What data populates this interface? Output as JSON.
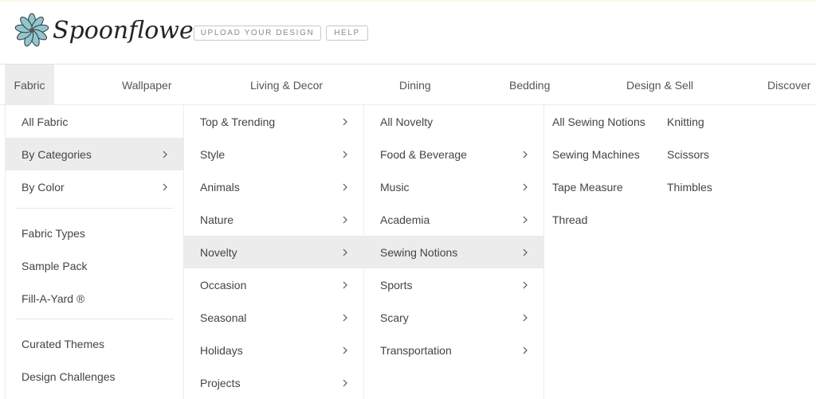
{
  "header": {
    "logo_text": "Spoonflower",
    "upload_button": "UPLOAD YOUR DESIGN",
    "help_button": "HELP"
  },
  "nav": {
    "items": [
      {
        "label": "Fabric",
        "active": true
      },
      {
        "label": "Wallpaper"
      },
      {
        "label": "Living & Decor"
      },
      {
        "label": "Dining"
      },
      {
        "label": "Bedding"
      },
      {
        "label": "Design & Sell"
      },
      {
        "label": "Discover"
      }
    ]
  },
  "menu": {
    "fabric": {
      "items": [
        {
          "label": "All Fabric",
          "has_submenu": false
        },
        {
          "label": "By Categories",
          "has_submenu": true,
          "selected": true
        },
        {
          "label": "By Color",
          "has_submenu": true
        },
        {
          "label": "Fabric Types",
          "has_submenu": false
        },
        {
          "label": "Sample Pack",
          "has_submenu": false
        },
        {
          "label": "Fill-A-Yard ®",
          "has_submenu": false
        },
        {
          "label": "Curated Themes",
          "has_submenu": false
        },
        {
          "label": "Design Challenges",
          "has_submenu": false
        }
      ]
    },
    "categories": {
      "items": [
        {
          "label": "Top & Trending",
          "has_submenu": true
        },
        {
          "label": "Style",
          "has_submenu": true
        },
        {
          "label": "Animals",
          "has_submenu": true
        },
        {
          "label": "Nature",
          "has_submenu": true
        },
        {
          "label": "Novelty",
          "has_submenu": true,
          "selected": true
        },
        {
          "label": "Occasion",
          "has_submenu": true
        },
        {
          "label": "Seasonal",
          "has_submenu": true
        },
        {
          "label": "Holidays",
          "has_submenu": true
        },
        {
          "label": "Projects",
          "has_submenu": true
        }
      ]
    },
    "novelty": {
      "items": [
        {
          "label": "All Novelty",
          "has_submenu": false
        },
        {
          "label": "Food & Beverage",
          "has_submenu": true
        },
        {
          "label": "Music",
          "has_submenu": true
        },
        {
          "label": "Academia",
          "has_submenu": true
        },
        {
          "label": "Sewing Notions",
          "has_submenu": true,
          "selected": true
        },
        {
          "label": "Sports",
          "has_submenu": true
        },
        {
          "label": "Scary",
          "has_submenu": true
        },
        {
          "label": "Transportation",
          "has_submenu": true
        }
      ]
    },
    "sewing_notions": {
      "items": [
        {
          "label": "All Sewing Notions"
        },
        {
          "label": "Knitting"
        },
        {
          "label": "Sewing Machines"
        },
        {
          "label": "Scissors"
        },
        {
          "label": "Tape Measure"
        },
        {
          "label": "Thimbles"
        },
        {
          "label": "Thread"
        }
      ]
    }
  },
  "colors": {
    "selected_bg": "#ececec",
    "logo_flower": "#8fc7cf",
    "text": "#444444"
  }
}
